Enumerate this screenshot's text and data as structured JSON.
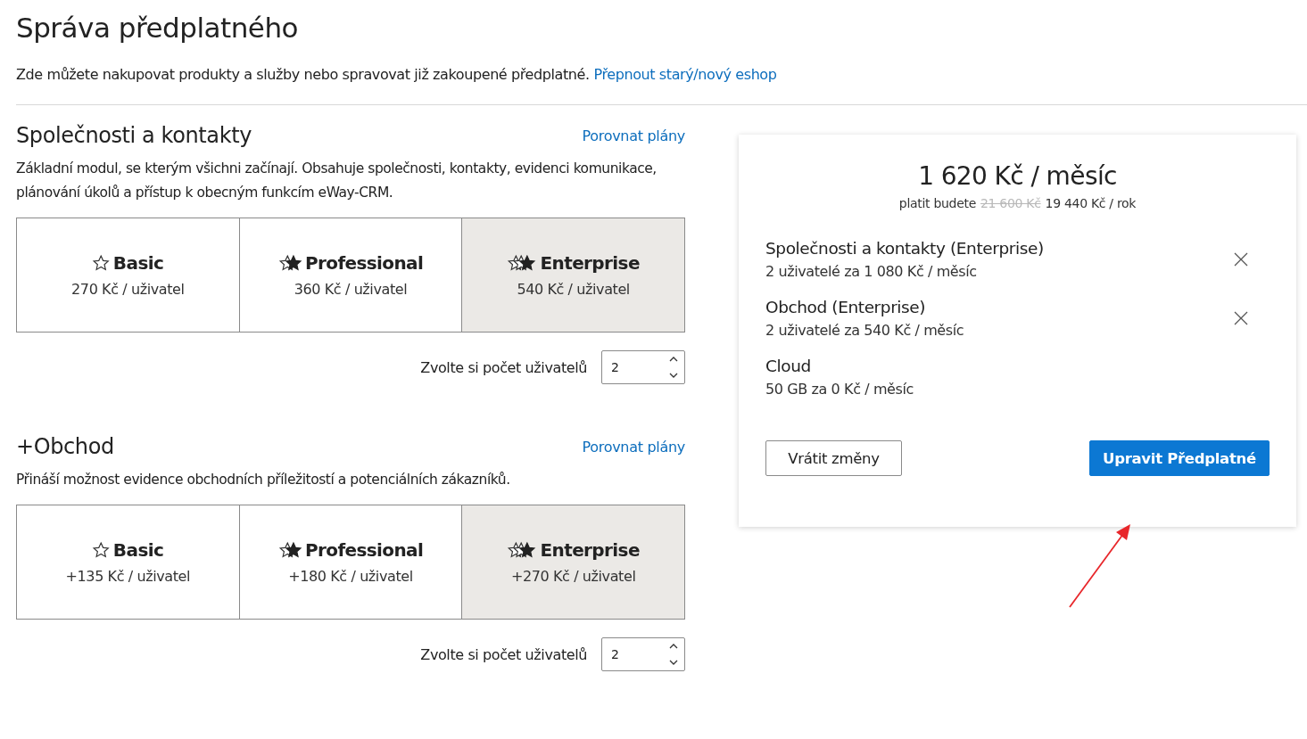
{
  "title": "Správa předplatného",
  "intro": {
    "text": "Zde můžete nakupovat produkty a služby nebo spravovat již zakoupené předplatné.",
    "link": "Přepnout starý/nový eshop"
  },
  "modules": [
    {
      "name": "Společnosti a kontakty",
      "compare_link": "Porovnat plány",
      "description": "Základní modul, se kterým všichni začínají. Obsahuje společnosti, kontakty, evidenci komunikace, plánování úkolů a přístup k obecným funkcím eWay-CRM.",
      "plans": [
        {
          "kind": "basic",
          "name": "Basic",
          "price": "270 Kč / uživatel",
          "selected": false
        },
        {
          "kind": "professional",
          "name": "Professional",
          "price": "360 Kč / uživatel",
          "selected": false
        },
        {
          "kind": "enterprise",
          "name": "Enterprise",
          "price": "540 Kč / uživatel",
          "selected": true
        }
      ],
      "users_label": "Zvolte si počet uživatelů",
      "users": "2"
    },
    {
      "name": "+Obchod",
      "compare_link": "Porovnat plány",
      "description": "Přináší možnost evidence obchodních příležitostí a potenciálních zákazníků.",
      "plans": [
        {
          "kind": "basic",
          "name": "Basic",
          "price": "+135 Kč / uživatel",
          "selected": false
        },
        {
          "kind": "professional",
          "name": "Professional",
          "price": "+180 Kč / uživatel",
          "selected": false
        },
        {
          "kind": "enterprise",
          "name": "Enterprise",
          "price": "+270 Kč / uživatel",
          "selected": true
        }
      ],
      "users_label": "Zvolte si počet uživatelů",
      "users": "2"
    }
  ],
  "summary": {
    "monthly": "1 620 Kč / měsíc",
    "yearly_prefix": "platit budete",
    "yearly_old": "21 600 Kč",
    "yearly_new": "19 440 Kč / rok",
    "items": [
      {
        "name": "Společnosti a kontakty (Enterprise)",
        "detail": "2 uživatelé za 1 080 Kč / měsíc",
        "removable": true
      },
      {
        "name": "Obchod (Enterprise)",
        "detail": "2 uživatelé za 540 Kč / měsíc",
        "removable": true
      },
      {
        "name": "Cloud",
        "detail": "50 GB za 0 Kč / měsíc",
        "removable": false
      }
    ],
    "buttons": [
      {
        "kind": "secondary",
        "label": "Vrátit změny"
      },
      {
        "kind": "primary",
        "label": "Upravit Předplatné"
      }
    ]
  },
  "annotations": [
    {
      "kind": "arrow"
    }
  ]
}
